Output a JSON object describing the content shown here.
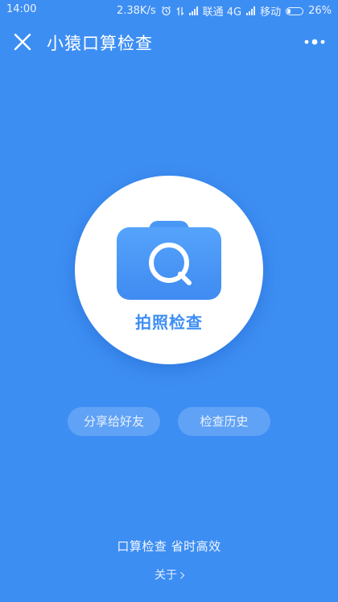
{
  "status_bar": {
    "time": "14:00",
    "speed": "2.38K/s",
    "carrier1": "联通 4G",
    "carrier2": "移动",
    "battery": "26%",
    "battery_level": 0.26,
    "icons": [
      "alarm-icon",
      "data-arrows-icon",
      "signal-icon",
      "battery-icon"
    ]
  },
  "header": {
    "title": "小猿口算检查",
    "close_icon": "close-icon",
    "more_icon": "more-dots-icon"
  },
  "main": {
    "photo_check_label": "拍照检查",
    "camera_icon": "camera-search-icon"
  },
  "actions": {
    "share_label": "分享给好友",
    "history_label": "检查历史"
  },
  "footer": {
    "slogan": "口算检查 省时高效",
    "about_label": "关于"
  },
  "colors": {
    "background": "#3d8ef3",
    "accent": "#3d8ef3",
    "camera_body": "#4896f5"
  }
}
